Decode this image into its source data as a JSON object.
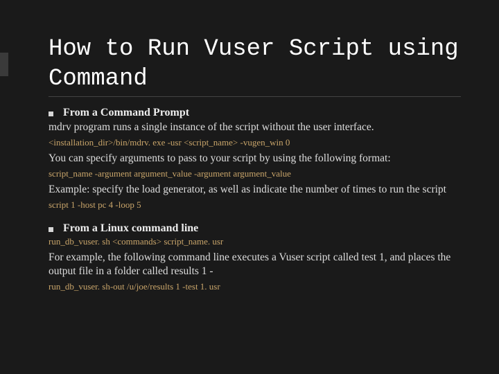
{
  "slide": {
    "title": "How to Run Vuser Script using Command",
    "bullet1": "From a Command Prompt",
    "line1": "mdrv program runs a single instance of the script without the user interface.",
    "cmd1": "<installation_dir>/bin/mdrv. exe -usr <script_name> -vugen_win 0",
    "line2": "You can specify arguments to pass to your script by using the following format:",
    "cmd2": "script_name  -argument argument_value  -argument argument_value",
    "line3": "Example: specify the load generator, as well as indicate the number of times to run the script",
    "cmd3": "script 1 -host pc 4 -loop 5",
    "bullet2": "From a Linux command line",
    "cmd4": "run_db_vuser. sh <commands> script_name. usr",
    "line4": "For example, the following command line executes a Vuser script called test 1, and places the output file in a folder called results 1 -",
    "cmd5": "run_db_vuser. sh-out /u/joe/results 1 -test 1. usr"
  }
}
